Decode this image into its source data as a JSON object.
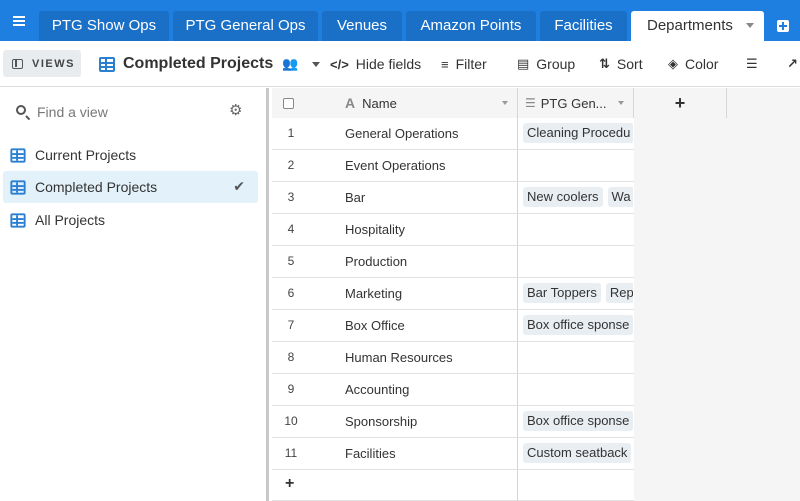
{
  "tabs": [
    "PTG Show Ops",
    "PTG General Ops",
    "Venues",
    "Amazon Points",
    "Facilities",
    "Departments"
  ],
  "toolbar": {
    "views_label": "VIEWS",
    "view_name": "Completed Projects",
    "hide_fields": "Hide fields",
    "filter": "Filter",
    "group": "Group",
    "sort": "Sort",
    "color": "Color"
  },
  "sidebar": {
    "search_placeholder": "Find a view",
    "views": [
      "Current Projects",
      "Completed Projects",
      "All Projects"
    ],
    "selected": "Completed Projects"
  },
  "grid": {
    "columns": [
      "Name",
      "PTG Gen..."
    ],
    "rows": [
      {
        "num": "1",
        "name": "General Operations",
        "links": [
          "Cleaning Procedu"
        ]
      },
      {
        "num": "2",
        "name": "Event Operations",
        "links": []
      },
      {
        "num": "3",
        "name": "Bar",
        "links": [
          "New coolers",
          "Wa"
        ]
      },
      {
        "num": "4",
        "name": "Hospitality",
        "links": []
      },
      {
        "num": "5",
        "name": "Production",
        "links": []
      },
      {
        "num": "6",
        "name": "Marketing",
        "links": [
          "Bar Toppers",
          "Rep"
        ]
      },
      {
        "num": "7",
        "name": "Box Office",
        "links": [
          "Box office sponse"
        ]
      },
      {
        "num": "8",
        "name": "Human Resources",
        "links": []
      },
      {
        "num": "9",
        "name": "Accounting",
        "links": []
      },
      {
        "num": "10",
        "name": "Sponsorship",
        "links": [
          "Box office sponse"
        ]
      },
      {
        "num": "11",
        "name": "Facilities",
        "links": [
          "Custom seatback"
        ]
      }
    ],
    "add_row": "+",
    "add_column": "+"
  },
  "colors": {
    "tabbar": "#1f7fe0",
    "accent": "#2b7fd1",
    "selected_view": "#e3f1fb"
  }
}
